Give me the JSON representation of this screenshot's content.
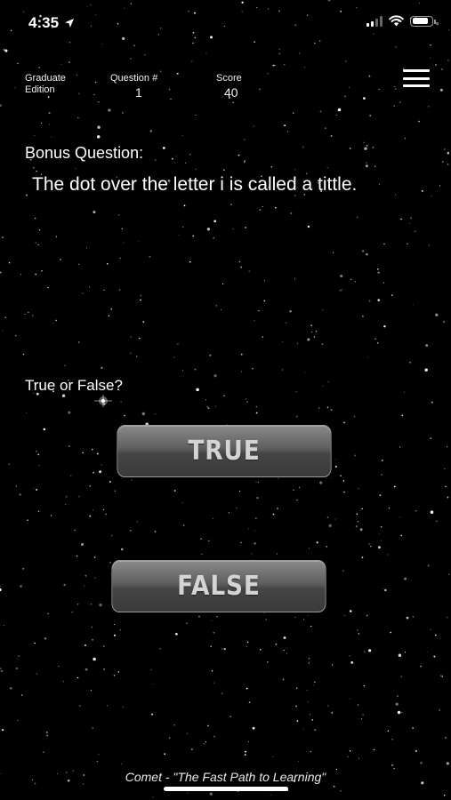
{
  "status_bar": {
    "time": "4:35",
    "location_icon": "location-arrow-icon",
    "signal_icon": "cellular-signal-icon",
    "wifi_icon": "wifi-icon",
    "battery_icon": "battery-icon",
    "battery_level": 0.85
  },
  "header": {
    "edition_label": "Graduate Edition",
    "question_label": "Question #",
    "question_value": "1",
    "score_label": "Score",
    "score_value": "40",
    "menu_icon": "hamburger-menu-icon"
  },
  "question": {
    "bonus_label": "Bonus Question:",
    "text": "The dot over the letter i is called a tittle."
  },
  "answers": {
    "prompt": "True or False?",
    "true_label": "TRUE",
    "false_label": "FALSE"
  },
  "footer": {
    "tagline": "Comet - \"The Fast Path to Learning\""
  },
  "colors": {
    "background": "#000000",
    "text": "#ffffff",
    "button_top": "#8a8a8a",
    "button_bottom": "#3a3a3a",
    "button_text": "#d4d4d4"
  }
}
